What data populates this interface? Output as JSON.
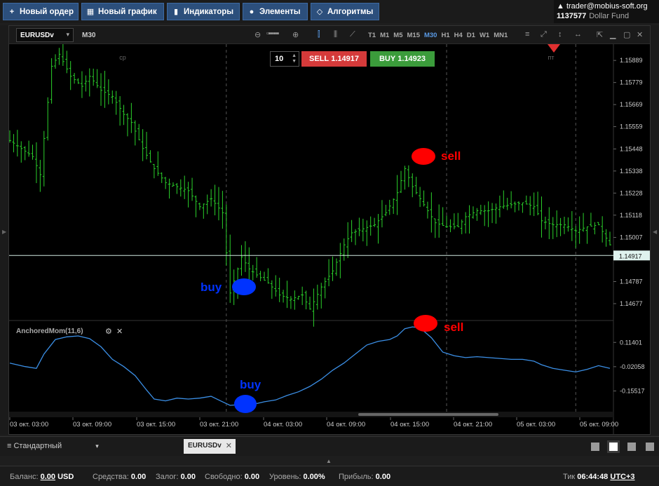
{
  "toolbar": {
    "new_order": "Новый ордер",
    "new_chart": "Новый график",
    "indicators": "Индикаторы",
    "elements": "Элементы",
    "algorithms": "Алгоритмы"
  },
  "account": {
    "user": "trader@mobius-soft.org",
    "number": "1137577",
    "fund": "Dollar Fund"
  },
  "chart_toolbar": {
    "symbol": "EURUSDv",
    "timeframe_label": "M30",
    "timeframes": [
      "T1",
      "M1",
      "M5",
      "M15",
      "M30",
      "H1",
      "H4",
      "D1",
      "W1",
      "MN1"
    ],
    "active_timeframe": "M30"
  },
  "trade": {
    "quantity": "10",
    "sell_label": "SELL",
    "sell_price": "1.14917",
    "buy_label": "BUY",
    "buy_price": "1.14923"
  },
  "chart_data": [
    {
      "type": "candlestick",
      "title": "",
      "symbol": "EURUSDv",
      "timeframe": "M30",
      "price_ticks": [
        "1.15889",
        "1.15779",
        "1.15669",
        "1.15559",
        "1.15448",
        "1.15338",
        "1.15228",
        "1.15118",
        "1.15007",
        "1.14787",
        "1.14677"
      ],
      "current_price_label": "1.14917",
      "day_markers": [
        "ср",
        "пт"
      ],
      "ylim": [
        1.146,
        1.1597
      ],
      "close_path": [
        [
          0,
          1.1549
        ],
        [
          6,
          1.1541
        ],
        [
          8,
          1.1532
        ],
        [
          11,
          1.1586
        ],
        [
          13,
          1.1592
        ],
        [
          16,
          1.1581
        ],
        [
          19,
          1.1576
        ],
        [
          21,
          1.1581
        ],
        [
          24,
          1.1574
        ],
        [
          27,
          1.1571
        ],
        [
          30,
          1.1562
        ],
        [
          32,
          1.1558
        ],
        [
          35,
          1.1545
        ],
        [
          38,
          1.1535
        ],
        [
          41,
          1.1528
        ],
        [
          44,
          1.1526
        ],
        [
          47,
          1.1524
        ],
        [
          50,
          1.1516
        ],
        [
          53,
          1.152
        ],
        [
          56,
          1.1513
        ],
        [
          58,
          1.1473
        ],
        [
          61,
          1.1491
        ],
        [
          63,
          1.1485
        ],
        [
          65,
          1.1482
        ],
        [
          68,
          1.1478
        ],
        [
          71,
          1.1472
        ],
        [
          74,
          1.147
        ],
        [
          77,
          1.1472
        ],
        [
          79,
          1.1465
        ],
        [
          82,
          1.1476
        ],
        [
          85,
          1.1484
        ],
        [
          88,
          1.1497
        ],
        [
          90,
          1.1503
        ],
        [
          93,
          1.1505
        ],
        [
          96,
          1.1507
        ],
        [
          99,
          1.1513
        ],
        [
          102,
          1.1523
        ],
        [
          104,
          1.1535
        ],
        [
          106,
          1.1526
        ],
        [
          109,
          1.1517
        ],
        [
          112,
          1.1508
        ],
        [
          115,
          1.1506
        ],
        [
          118,
          1.1506
        ],
        [
          120,
          1.1511
        ],
        [
          123,
          1.1514
        ],
        [
          126,
          1.1514
        ],
        [
          129,
          1.1516
        ],
        [
          132,
          1.1517
        ],
        [
          135,
          1.1518
        ],
        [
          138,
          1.1516
        ],
        [
          140,
          1.1509
        ],
        [
          143,
          1.1507
        ],
        [
          146,
          1.1507
        ],
        [
          149,
          1.1504
        ],
        [
          152,
          1.1506
        ],
        [
          155,
          1.1507
        ],
        [
          158,
          1.1497
        ]
      ]
    },
    {
      "type": "line",
      "title": "AnchoredMom(11,6)",
      "y_ticks": [
        "0.11401",
        "-0.02058",
        "-0.15517"
      ],
      "series": [
        {
          "values": [
            [
              0,
              -0.0005
            ],
            [
              4,
              -0.02
            ],
            [
              7,
              -0.03
            ],
            [
              9,
              0.05
            ],
            [
              12,
              0.13
            ],
            [
              15,
              0.145
            ],
            [
              18,
              0.15
            ],
            [
              21,
              0.135
            ],
            [
              24,
              0.09
            ],
            [
              27,
              0.02
            ],
            [
              30,
              -0.02
            ],
            [
              33,
              -0.07
            ],
            [
              36,
              -0.15
            ],
            [
              38,
              -0.2
            ],
            [
              41,
              -0.21
            ],
            [
              44,
              -0.195
            ],
            [
              47,
              -0.2
            ],
            [
              50,
              -0.195
            ],
            [
              53,
              -0.185
            ],
            [
              56,
              -0.215
            ],
            [
              58,
              -0.235
            ],
            [
              61,
              -0.23
            ],
            [
              64,
              -0.23
            ],
            [
              67,
              -0.215
            ],
            [
              70,
              -0.205
            ],
            [
              73,
              -0.18
            ],
            [
              76,
              -0.16
            ],
            [
              79,
              -0.13
            ],
            [
              82,
              -0.09
            ],
            [
              85,
              -0.04
            ],
            [
              88,
              0.0
            ],
            [
              91,
              0.05
            ],
            [
              94,
              0.1
            ],
            [
              97,
              0.12
            ],
            [
              100,
              0.13
            ],
            [
              102,
              0.15
            ],
            [
              104,
              0.19
            ],
            [
              106,
              0.2
            ],
            [
              108,
              0.195
            ],
            [
              111,
              0.14
            ],
            [
              114,
              0.06
            ],
            [
              117,
              0.04
            ],
            [
              120,
              0.03
            ],
            [
              123,
              0.035
            ],
            [
              126,
              0.03
            ],
            [
              129,
              0.025
            ],
            [
              132,
              0.02
            ],
            [
              135,
              0.02
            ],
            [
              138,
              0.01
            ],
            [
              140,
              -0.01
            ],
            [
              143,
              -0.03
            ],
            [
              146,
              -0.04
            ],
            [
              149,
              -0.05
            ],
            [
              152,
              -0.035
            ],
            [
              155,
              -0.015
            ],
            [
              158,
              -0.03
            ]
          ]
        }
      ],
      "x_ticks": [
        "03 окт. 03:00",
        "03 окт. 09:00",
        "03 окт. 15:00",
        "03 окт. 21:00",
        "04 окт. 03:00",
        "04 окт. 09:00",
        "04 окт. 15:00",
        "04 окт. 21:00",
        "05 окт. 03:00",
        "05 окт. 09:00"
      ]
    }
  ],
  "annotations": {
    "buy_top": "buy",
    "sell_top": "sell",
    "buy_bottom": "buy",
    "sell_bottom": "sell"
  },
  "bottom": {
    "template": "Стандартный",
    "tab": "EURUSDv"
  },
  "status": {
    "balance_label": "Баланс:",
    "balance_value": "0.00",
    "balance_currency": "USD",
    "funds_label": "Средства:",
    "funds_value": "0.00",
    "margin_label": "Залог:",
    "margin_value": "0.00",
    "free_label": "Свободно:",
    "free_value": "0.00",
    "level_label": "Уровень:",
    "level_value": "0.00%",
    "profit_label": "Прибыль:",
    "profit_value": "0.00",
    "tick_label": "Тик",
    "tick_value": "06:44:48",
    "timezone": "UTC+3"
  },
  "colors": {
    "up_candle": "#2bd12b",
    "indicator_line": "#3b8fe6",
    "sell_red": "#d53a3a",
    "buy_green": "#3b9c3b",
    "annotation_red": "#ff0000",
    "annotation_blue": "#0033ff"
  }
}
